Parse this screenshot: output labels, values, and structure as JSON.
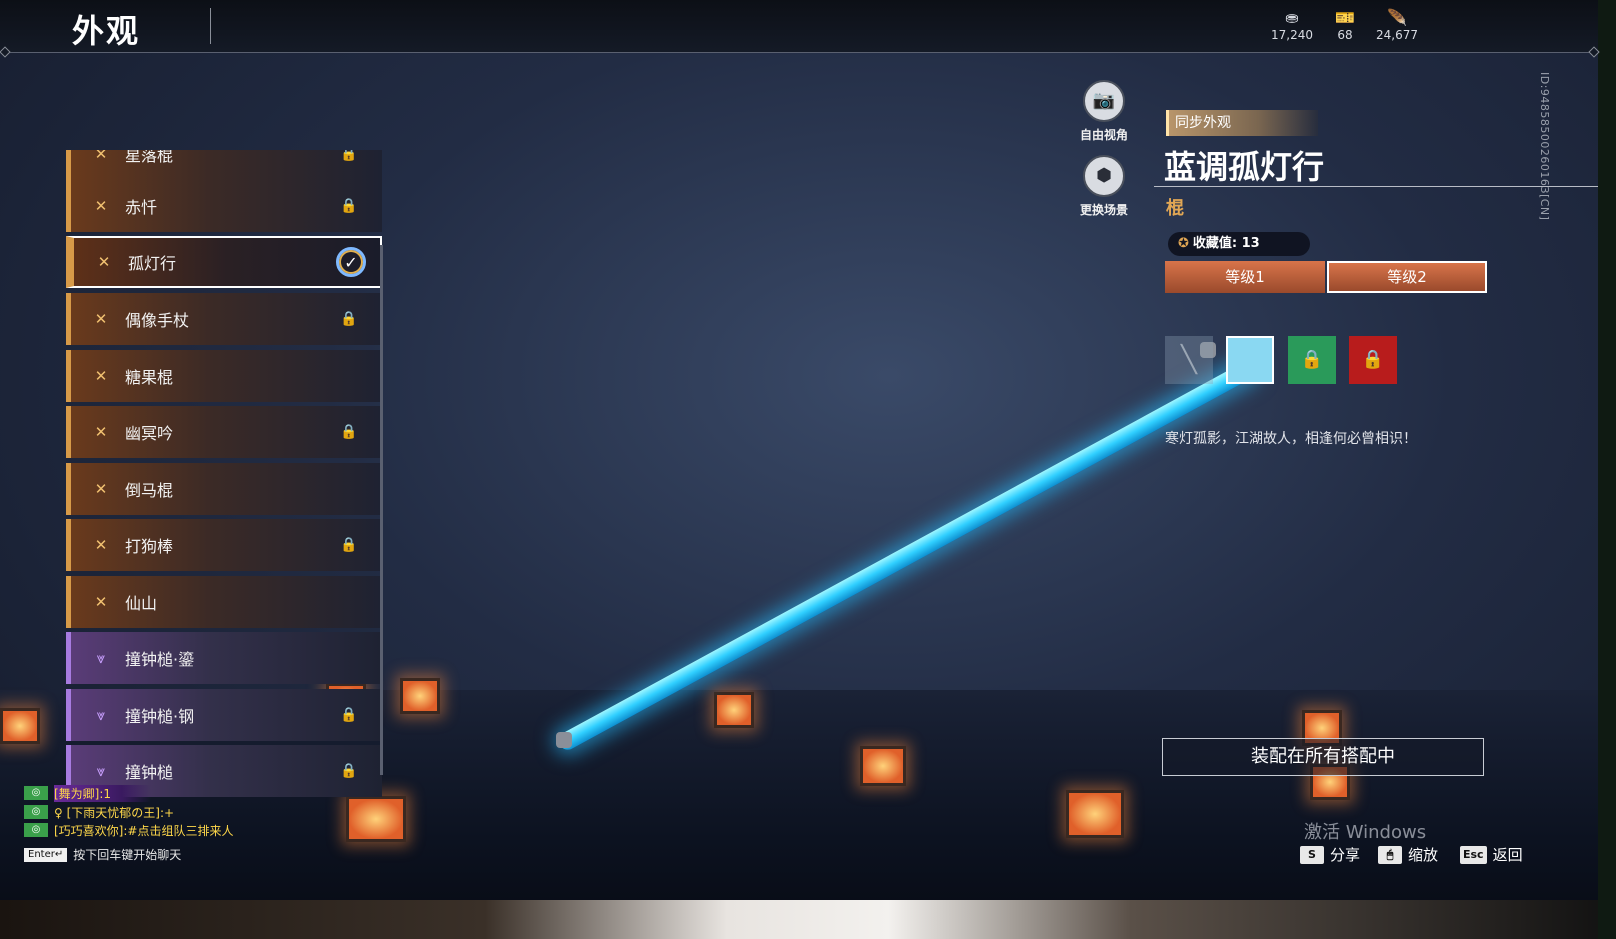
{
  "header": {
    "title": "外观",
    "currencies": [
      {
        "icon": "coin-icon",
        "glyph": "⛂",
        "value": "17,240",
        "color": "#d8dbe2"
      },
      {
        "icon": "ticket-icon",
        "glyph": "🎫",
        "value": "68",
        "color": "#f0c040"
      },
      {
        "icon": "feather-icon",
        "glyph": "🪶",
        "value": "24,677",
        "color": "#40c0f0"
      }
    ]
  },
  "list": {
    "items": [
      {
        "name": "星落棍",
        "tier": "orange",
        "locked": true
      },
      {
        "name": "赤忏",
        "tier": "orange",
        "locked": true
      },
      {
        "name": "孤灯行",
        "tier": "orange",
        "locked": false,
        "selected": true
      },
      {
        "name": "偶像手杖",
        "tier": "orange",
        "locked": true
      },
      {
        "name": "糖果棍",
        "tier": "orange",
        "locked": false
      },
      {
        "name": "幽冥吟",
        "tier": "orange",
        "locked": true
      },
      {
        "name": "倒马棍",
        "tier": "orange",
        "locked": false
      },
      {
        "name": "打狗棒",
        "tier": "orange",
        "locked": true
      },
      {
        "name": "仙山",
        "tier": "orange",
        "locked": false
      },
      {
        "name": "撞钟槌·鎏",
        "tier": "purple",
        "locked": false
      },
      {
        "name": "撞钟槌·钢",
        "tier": "purple",
        "locked": true
      },
      {
        "name": "撞钟槌",
        "tier": "purple",
        "locked": true
      }
    ]
  },
  "camera": {
    "free_view": "自由视角",
    "change_scene": "更换场景"
  },
  "detail": {
    "sync_tag": "同步外观",
    "title": "蓝调孤灯行",
    "category": "棍",
    "collect_label": "收藏值: 13",
    "levels": [
      "等级1",
      "等级2"
    ],
    "active_level_index": 1,
    "swatches": [
      {
        "type": "none",
        "color": "#8ca0b4"
      },
      {
        "type": "color",
        "color": "#8ad8f2",
        "selected": true
      },
      {
        "type": "locked",
        "color": "#2a9a5a"
      },
      {
        "type": "locked",
        "color": "#b81c1c"
      }
    ],
    "description": "寒灯孤影，江湖故人，相逢何必曾相识！",
    "equip_button": "装配在所有搭配中"
  },
  "footer": {
    "activate_watermark": "激活 Windows",
    "hints": [
      {
        "key": "S",
        "label": "分享"
      },
      {
        "key": "🖱",
        "label": "缩放"
      },
      {
        "key": "Esc",
        "label": "返回"
      }
    ]
  },
  "side_id": "ID:9485850026016З[CN]",
  "chat": {
    "lines": [
      {
        "text": "[舞为卿]:1"
      },
      {
        "text": "♀ [下雨天忧郁の王]:+"
      },
      {
        "text": "[巧巧喜欢你]:#点击组队三排来人"
      }
    ],
    "enter_key": "Enter↵",
    "input_hint": "按下回车键开始聊天"
  },
  "colors": {
    "orange_accent": "#d79a48",
    "purple_accent": "#a77be0",
    "gold_text": "#e0a654",
    "staff_glow": "#30cfff"
  }
}
